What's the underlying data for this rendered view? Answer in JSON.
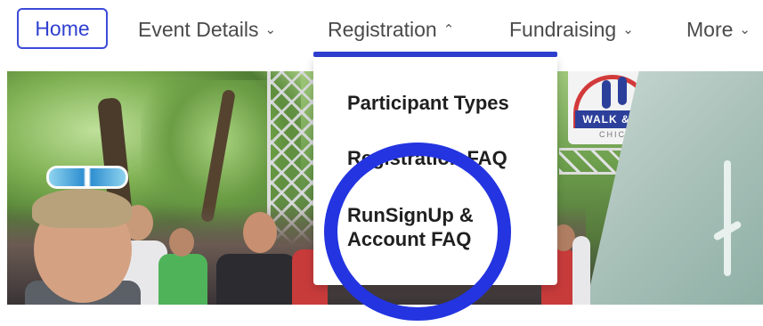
{
  "nav": {
    "home": "Home",
    "items": [
      {
        "label": "Event Details",
        "chevron": "⌄",
        "icon": "chevron-down-icon"
      },
      {
        "label": "Registration",
        "chevron": "⌃",
        "icon": "chevron-up-icon",
        "active": true
      },
      {
        "label": "Fundraising",
        "chevron": "⌄",
        "icon": "chevron-down-icon"
      },
      {
        "label": "More",
        "chevron": "⌄",
        "icon": "chevron-down-icon"
      }
    ],
    "accent_color": "#2f3fd0"
  },
  "dropdown": {
    "items": [
      {
        "label": "Participant Types"
      },
      {
        "label": "Registration FAQ"
      },
      {
        "label": "RunSignUp & Account FAQ"
      }
    ]
  },
  "hero": {
    "banner_text": "WALK & R",
    "banner_sub": "CHIC"
  },
  "annotation": {
    "color": "#2334e0"
  }
}
